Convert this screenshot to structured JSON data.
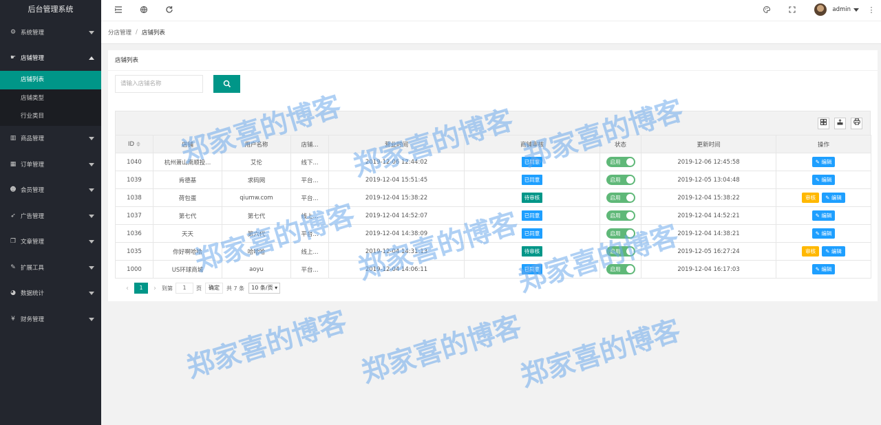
{
  "app": {
    "title": "后台管理系统"
  },
  "sidebar": {
    "items": [
      {
        "label": "系统管理",
        "icon": "gear-icon",
        "glyph": "⚙",
        "open": false
      },
      {
        "label": "店铺管理",
        "icon": "hand-icon",
        "glyph": "☛",
        "open": true,
        "children": [
          {
            "label": "店铺列表",
            "active": true
          },
          {
            "label": "店铺类型",
            "active": false
          },
          {
            "label": "行业类目",
            "active": false
          }
        ]
      },
      {
        "label": "商品管理",
        "icon": "chart-icon",
        "glyph": "▥",
        "open": false
      },
      {
        "label": "订单管理",
        "icon": "calendar-icon",
        "glyph": "▦",
        "open": false
      },
      {
        "label": "会员管理",
        "icon": "users-icon",
        "glyph": "☻",
        "open": false
      },
      {
        "label": "广告管理",
        "icon": "rocket-icon",
        "glyph": "➶",
        "open": false
      },
      {
        "label": "文章管理",
        "icon": "copy-icon",
        "glyph": "❐",
        "open": false
      },
      {
        "label": "扩展工具",
        "icon": "wrench-icon",
        "glyph": "✎",
        "open": false
      },
      {
        "label": "数据统计",
        "icon": "pie-icon",
        "glyph": "◕",
        "open": false
      },
      {
        "label": "财务管理",
        "icon": "yen-icon",
        "glyph": "¥",
        "open": false
      }
    ]
  },
  "topbar": {
    "user": "admin",
    "icons": [
      "menu-toggle-icon",
      "globe-icon",
      "refresh-icon",
      "palette-icon",
      "fullscreen-icon",
      "more-icon"
    ]
  },
  "breadcrumb": {
    "parent": "分店管理",
    "separator": "/",
    "current": "店铺列表"
  },
  "card": {
    "title": "店铺列表",
    "search": {
      "placeholder": "请输入店铺名称"
    }
  },
  "table": {
    "columns": [
      "ID",
      "店铺",
      "用户名称",
      "店铺...",
      "营业时间",
      "商铺审核",
      "状态",
      "更新时间",
      "操作"
    ],
    "rows": [
      {
        "id": "1040",
        "shop": "杭州萧山南顺投...",
        "user": "艾伦",
        "type": "线下...",
        "open_time": "2019-12-06 12:44:02",
        "audit": "已同意",
        "audit_color": "#1e9fff",
        "status": "启用",
        "updated": "2019-12-06 12:45:58",
        "can_audit": false
      },
      {
        "id": "1039",
        "shop": "肯德基",
        "user": "求码网",
        "type": "平台...",
        "open_time": "2019-12-04 15:51:45",
        "audit": "已同意",
        "audit_color": "#1e9fff",
        "status": "启用",
        "updated": "2019-12-05 13:04:48",
        "can_audit": false
      },
      {
        "id": "1038",
        "shop": "荷包蛋",
        "user": "qiumw.com",
        "type": "平台...",
        "open_time": "2019-12-04 15:38:22",
        "audit": "待审核",
        "audit_color": "#009688",
        "status": "启用",
        "updated": "2019-12-04 15:38:22",
        "can_audit": true
      },
      {
        "id": "1037",
        "shop": "第七代",
        "user": "第七代",
        "type": "线上...",
        "open_time": "2019-12-04 14:52:07",
        "audit": "已同意",
        "audit_color": "#1e9fff",
        "status": "启用",
        "updated": "2019-12-04 14:52:21",
        "can_audit": false
      },
      {
        "id": "1036",
        "shop": "天天",
        "user": "第六代",
        "type": "平台...",
        "open_time": "2019-12-04 14:38:09",
        "audit": "已同意",
        "audit_color": "#1e9fff",
        "status": "启用",
        "updated": "2019-12-04 14:38:21",
        "can_audit": false
      },
      {
        "id": "1035",
        "shop": "你好啊哈哈",
        "user": "哈哈哈",
        "type": "线上...",
        "open_time": "2019-12-04 14:31:13",
        "audit": "待审核",
        "audit_color": "#009688",
        "status": "启用",
        "updated": "2019-12-05 16:27:24",
        "can_audit": true
      },
      {
        "id": "1000",
        "shop": "US环球商城",
        "user": "aoyu",
        "type": "平台...",
        "open_time": "2019-12-04 14:06:11",
        "audit": "已同意",
        "audit_color": "#1e9fff",
        "status": "启用",
        "updated": "2019-12-04 16:17:03",
        "can_audit": false
      }
    ],
    "actions": {
      "audit": "审核",
      "edit": "编辑"
    },
    "toolbar_icons": [
      "columns-icon",
      "export-icon",
      "print-icon"
    ]
  },
  "pager": {
    "current": "1",
    "goto_label": "到第",
    "goto_value": "1",
    "page_unit": "页",
    "confirm": "确定",
    "total": "共 7 条",
    "page_size": "10 条/页"
  },
  "watermark": "郑家喜的博客"
}
